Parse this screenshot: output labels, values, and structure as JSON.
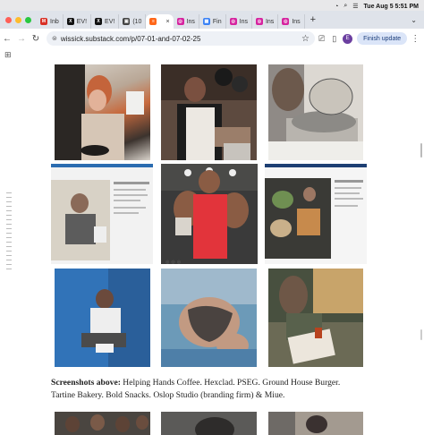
{
  "menubar": {
    "clock": "Tue Aug 5  5:51 PM"
  },
  "tabs": [
    {
      "label": "Inb",
      "icon": "gmail-icon",
      "color": "#d93025",
      "glyph": "M"
    },
    {
      "label": "EV!",
      "icon": "x-icon",
      "color": "#111111",
      "glyph": "X"
    },
    {
      "label": "EV!",
      "icon": "x-icon",
      "color": "#111111",
      "glyph": "X"
    },
    {
      "label": "(10",
      "icon": "app-icon",
      "color": "#444444",
      "glyph": "▣"
    },
    {
      "label": "",
      "icon": "substack-icon",
      "color": "#ff6719",
      "glyph": "≡",
      "active": true
    },
    {
      "label": "Ins",
      "icon": "instagram-icon",
      "color": "#d6249f",
      "glyph": "◎"
    },
    {
      "label": "Fin",
      "icon": "finder-icon",
      "color": "#3b82f6",
      "glyph": "▦"
    },
    {
      "label": "Ins",
      "icon": "instagram-icon",
      "color": "#d6249f",
      "glyph": "◎"
    },
    {
      "label": "Ins",
      "icon": "instagram-icon",
      "color": "#d6249f",
      "glyph": "◎"
    },
    {
      "label": "Ins",
      "icon": "instagram-icon",
      "color": "#d6249f",
      "glyph": "◎"
    }
  ],
  "toolbar": {
    "url": "wissick.substack.com/p/07-01-and-07-02-25",
    "avatar_letter": "E",
    "update_label": "Finish update"
  },
  "caption": {
    "bold": "Screenshots above:",
    "text": " Helping Hands Coffee. Hexclad. PSEG. Ground House Burger. Tartine Bakery. Bold Snacks. Oslop Studio (branding firm) & Miue."
  },
  "colors": {
    "tabbar": "#dfe3ea",
    "accent": "#1a73e8"
  }
}
